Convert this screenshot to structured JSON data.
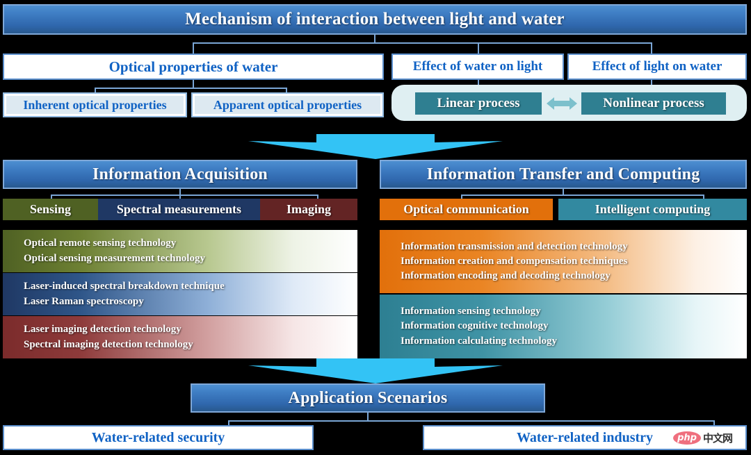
{
  "diagram": {
    "root": {
      "title": "Mechanism of interaction between light and water"
    },
    "level2": [
      {
        "label": "Optical properties of water"
      },
      {
        "label": "Effect of water on light"
      },
      {
        "label": "Effect of light on water"
      }
    ],
    "optical_properties_children": [
      {
        "label": "Inherent optical properties"
      },
      {
        "label": "Apparent optical properties"
      }
    ],
    "process_group": {
      "left": "Linear process",
      "right": "Nonlinear process",
      "arrow_icon": "double-arrow-icon",
      "container_color": "#dfeff2",
      "box_color": "#2f7f91",
      "arrow_color": "#7cc0cc"
    },
    "columns": [
      {
        "title": "Information Acquisition",
        "categories": [
          {
            "label": "Sensing",
            "color": "#4f6123"
          },
          {
            "label": "Spectral measurements",
            "color": "#1f3864"
          },
          {
            "label": "Imaging",
            "color": "#632424"
          }
        ],
        "panels": [
          {
            "color": "#4f6123",
            "items": [
              "Optical remote sensing technology",
              "Optical sensing measurement technology"
            ]
          },
          {
            "color": "#1f3864",
            "items": [
              "Laser-induced spectral breakdown technique",
              "Laser Raman spectroscopy"
            ]
          },
          {
            "color": "#7b2b2b",
            "items": [
              "Laser imaging detection technology",
              "Spectral imaging detection technology"
            ]
          }
        ]
      },
      {
        "title": "Information Transfer and Computing",
        "categories": [
          {
            "label": "Optical communication",
            "color": "#e2700b"
          },
          {
            "label": "Intelligent computing",
            "color": "#3289a0"
          }
        ],
        "panels": [
          {
            "color": "#e2700b",
            "items": [
              "Information transmission and detection technology",
              "Information creation and compensation techniques",
              "Information encoding and decoding technology"
            ]
          },
          {
            "color": "#2d7f92",
            "items": [
              "Information sensing technology",
              "Information cognitive technology",
              "Information calculating technology"
            ]
          }
        ]
      }
    ],
    "application": {
      "title": "Application Scenarios",
      "children": [
        {
          "label": "Water-related security"
        },
        {
          "label": "Water-related industry"
        }
      ]
    },
    "arrows": {
      "color": "#33c3f5",
      "icon": "down-arrow-icon"
    },
    "watermark": {
      "brand": "php",
      "site": "中文网"
    }
  }
}
